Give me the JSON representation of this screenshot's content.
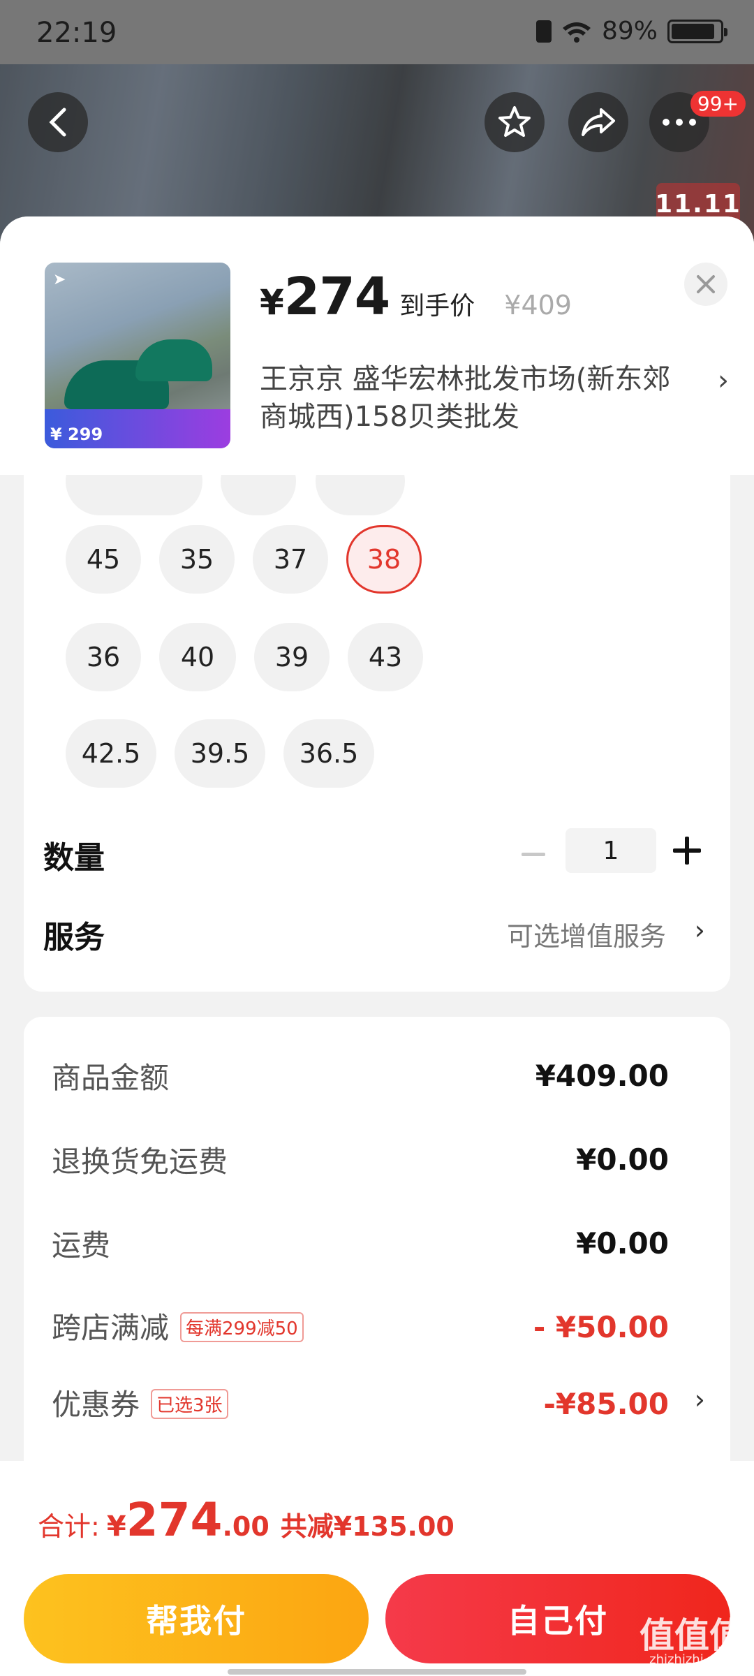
{
  "status_bar": {
    "time": "22:19",
    "battery": "89%",
    "battery_level": 0.89
  },
  "top_nav": {
    "badge": "99+",
    "promo": "11.11"
  },
  "product": {
    "currency": "¥",
    "price": "274",
    "price_label": "到手价",
    "original_price": "¥409",
    "store": "王京京  盛华宏林批发市场(新东郊商城西)158贝类批发",
    "thumb_promo_price": "¥ 299"
  },
  "sizes": [
    {
      "label": "45",
      "selected": false
    },
    {
      "label": "35",
      "selected": false
    },
    {
      "label": "37",
      "selected": false
    },
    {
      "label": "38",
      "selected": true
    },
    {
      "label": "36",
      "selected": false
    },
    {
      "label": "40",
      "selected": false
    },
    {
      "label": "39",
      "selected": false
    },
    {
      "label": "43",
      "selected": false
    },
    {
      "label": "42.5",
      "selected": false
    },
    {
      "label": "39.5",
      "selected": false
    },
    {
      "label": "36.5",
      "selected": false
    }
  ],
  "quantity": {
    "label": "数量",
    "value": "1"
  },
  "service": {
    "label": "服务",
    "value": "可选增值服务"
  },
  "summary": {
    "goods_amount": {
      "label": "商品金额",
      "value": "¥409.00"
    },
    "return_shipping": {
      "label": "退换货免运费",
      "value": "¥0.00"
    },
    "shipping": {
      "label": "运费",
      "value": "¥0.00"
    },
    "cross_store": {
      "label": "跨店满减",
      "tag": "每满299减50",
      "value": "- ¥50.00"
    },
    "coupon": {
      "label": "优惠券",
      "tag": "已选3张",
      "value": "-¥85.00"
    }
  },
  "footer": {
    "total_label": "合计:",
    "total_yen": "¥",
    "total_int": "274",
    "total_dec": ".00",
    "total_save": "共减¥135.00",
    "btn_help": "帮我付",
    "btn_self": "自己付"
  },
  "watermark": {
    "main": "值值值",
    "sub": "zhizhizhi.com"
  },
  "colors": {
    "accent_red": "#e2362c",
    "btn_yellow": "#fca511",
    "btn_red": "#f0261c"
  }
}
